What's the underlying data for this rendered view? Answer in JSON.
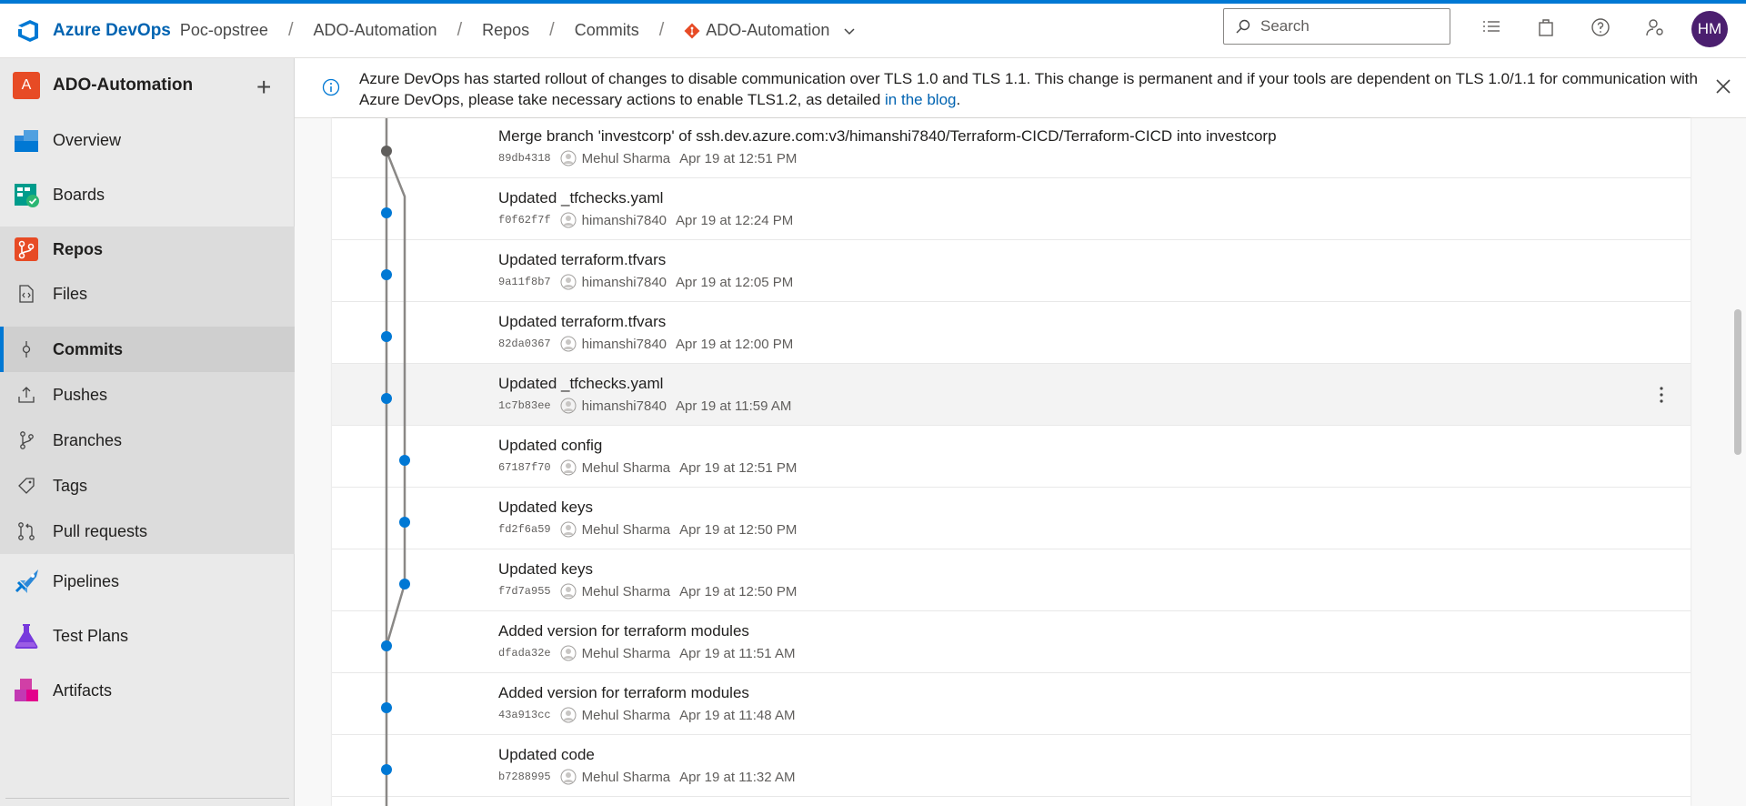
{
  "header": {
    "brand": "Azure DevOps",
    "breadcrumbs": [
      "Poc-opstree",
      "ADO-Automation",
      "Repos",
      "Commits"
    ],
    "repo_selector": "ADO-Automation",
    "search_placeholder": "Search",
    "avatar_initials": "HM",
    "icons": [
      "list-icon",
      "shopping-bag-icon",
      "help-icon",
      "user-settings-icon"
    ]
  },
  "sidebar": {
    "project_initial": "A",
    "project_name": "ADO-Automation",
    "items": [
      {
        "label": "Overview",
        "icon": "overview-icon"
      },
      {
        "label": "Boards",
        "icon": "boards-icon"
      },
      {
        "label": "Repos",
        "icon": "repos-icon"
      },
      {
        "label": "Files",
        "icon": "files-icon"
      },
      {
        "label": "Commits",
        "icon": "commit-icon",
        "selected": true
      },
      {
        "label": "Pushes",
        "icon": "pushes-icon"
      },
      {
        "label": "Branches",
        "icon": "branch-icon"
      },
      {
        "label": "Tags",
        "icon": "tag-icon"
      },
      {
        "label": "Pull requests",
        "icon": "pull-request-icon"
      },
      {
        "label": "Pipelines",
        "icon": "pipelines-icon"
      },
      {
        "label": "Test Plans",
        "icon": "test-plans-icon"
      },
      {
        "label": "Artifacts",
        "icon": "artifacts-icon"
      }
    ]
  },
  "banner": {
    "text": "Azure DevOps has started rollout of changes to disable communication over TLS 1.0 and TLS 1.1. This change is permanent and if your tools are dependent on TLS 1.0/1.1 for communication with Azure DevOps, please take necessary actions to enable TLS1.2, as detailed ",
    "link": "in the blog",
    "suffix": "."
  },
  "commits": [
    {
      "message": "Merge branch 'investcorp' of ssh.dev.azure.com:v3/himanshi7840/Terraform-CICD/Terraform-CICD into investcorp",
      "hash": "89db4318",
      "author": "Mehul Sharma",
      "date": "Apr 19 at 12:51 PM"
    },
    {
      "message": "Updated _tfchecks.yaml",
      "hash": "f0f62f7f",
      "author": "himanshi7840",
      "date": "Apr 19 at 12:24 PM"
    },
    {
      "message": "Updated terraform.tfvars",
      "hash": "9a11f8b7",
      "author": "himanshi7840",
      "date": "Apr 19 at 12:05 PM"
    },
    {
      "message": "Updated terraform.tfvars",
      "hash": "82da0367",
      "author": "himanshi7840",
      "date": "Apr 19 at 12:00 PM"
    },
    {
      "message": "Updated _tfchecks.yaml",
      "hash": "1c7b83ee",
      "author": "himanshi7840",
      "date": "Apr 19 at 11:59 AM"
    },
    {
      "message": "Updated config",
      "hash": "67187f70",
      "author": "Mehul Sharma",
      "date": "Apr 19 at 12:51 PM"
    },
    {
      "message": "Updated keys",
      "hash": "fd2f6a59",
      "author": "Mehul Sharma",
      "date": "Apr 19 at 12:50 PM"
    },
    {
      "message": "Updated keys",
      "hash": "f7d7a955",
      "author": "Mehul Sharma",
      "date": "Apr 19 at 12:50 PM"
    },
    {
      "message": "Added version for terraform modules",
      "hash": "dfada32e",
      "author": "Mehul Sharma",
      "date": "Apr 19 at 11:51 AM"
    },
    {
      "message": "Added version for terraform modules",
      "hash": "43a913cc",
      "author": "Mehul Sharma",
      "date": "Apr 19 at 11:48 AM"
    },
    {
      "message": "Updated code",
      "hash": "b7288995",
      "author": "Mehul Sharma",
      "date": "Apr 19 at 11:32 AM"
    }
  ],
  "colors": {
    "accent": "#0078d4",
    "node": "#0078d4",
    "merge_node": "#605e5c",
    "line": "#8a8886"
  }
}
